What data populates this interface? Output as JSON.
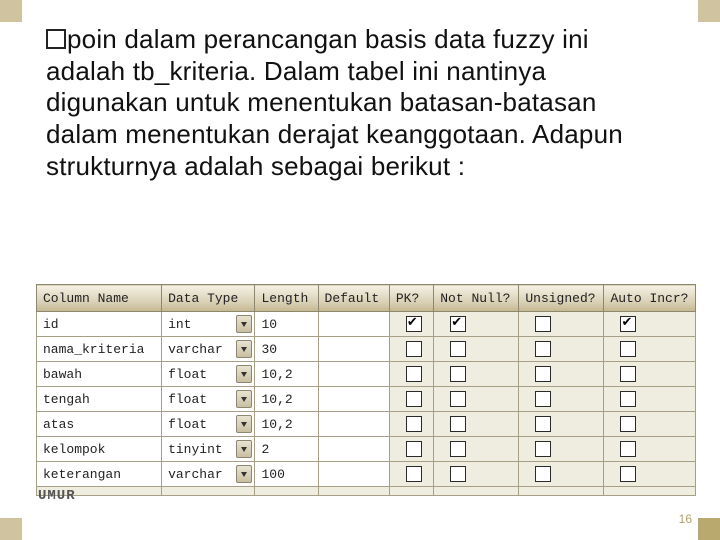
{
  "body_text": "poin dalam perancangan basis data fuzzy ini adalah tb_kriteria. Dalam tabel ini nantinya digunakan untuk menentukan batasan-batasan dalam menentukan derajat keanggotaan. Adapun strukturnya adalah sebagai berikut :",
  "table": {
    "headers": [
      "Column Name",
      "Data Type",
      "Length",
      "Default",
      "PK?",
      "Not Null?",
      "Unsigned?",
      "Auto Incr?"
    ],
    "rows": [
      {
        "name": "id",
        "dtype": "int",
        "length": "10",
        "default": "",
        "pk": true,
        "notnull": true,
        "unsigned": false,
        "autoincr": true
      },
      {
        "name": "nama_kriteria",
        "dtype": "varchar",
        "length": "30",
        "default": "",
        "pk": false,
        "notnull": false,
        "unsigned": false,
        "autoincr": false
      },
      {
        "name": "bawah",
        "dtype": "float",
        "length": "10,2",
        "default": "",
        "pk": false,
        "notnull": false,
        "unsigned": false,
        "autoincr": false
      },
      {
        "name": "tengah",
        "dtype": "float",
        "length": "10,2",
        "default": "",
        "pk": false,
        "notnull": false,
        "unsigned": false,
        "autoincr": false
      },
      {
        "name": "atas",
        "dtype": "float",
        "length": "10,2",
        "default": "",
        "pk": false,
        "notnull": false,
        "unsigned": false,
        "autoincr": false
      },
      {
        "name": "kelompok",
        "dtype": "tinyint",
        "length": "2",
        "default": "",
        "pk": false,
        "notnull": false,
        "unsigned": false,
        "autoincr": false
      },
      {
        "name": "keterangan",
        "dtype": "varchar",
        "length": "100",
        "default": "",
        "pk": false,
        "notnull": false,
        "unsigned": false,
        "autoincr": false
      },
      {
        "name": "",
        "dtype": "",
        "length": "",
        "default": "",
        "pk": false,
        "notnull": false,
        "unsigned": false,
        "autoincr": false,
        "partial": true
      }
    ]
  },
  "footer_label": "UMUR",
  "page_number": "16"
}
